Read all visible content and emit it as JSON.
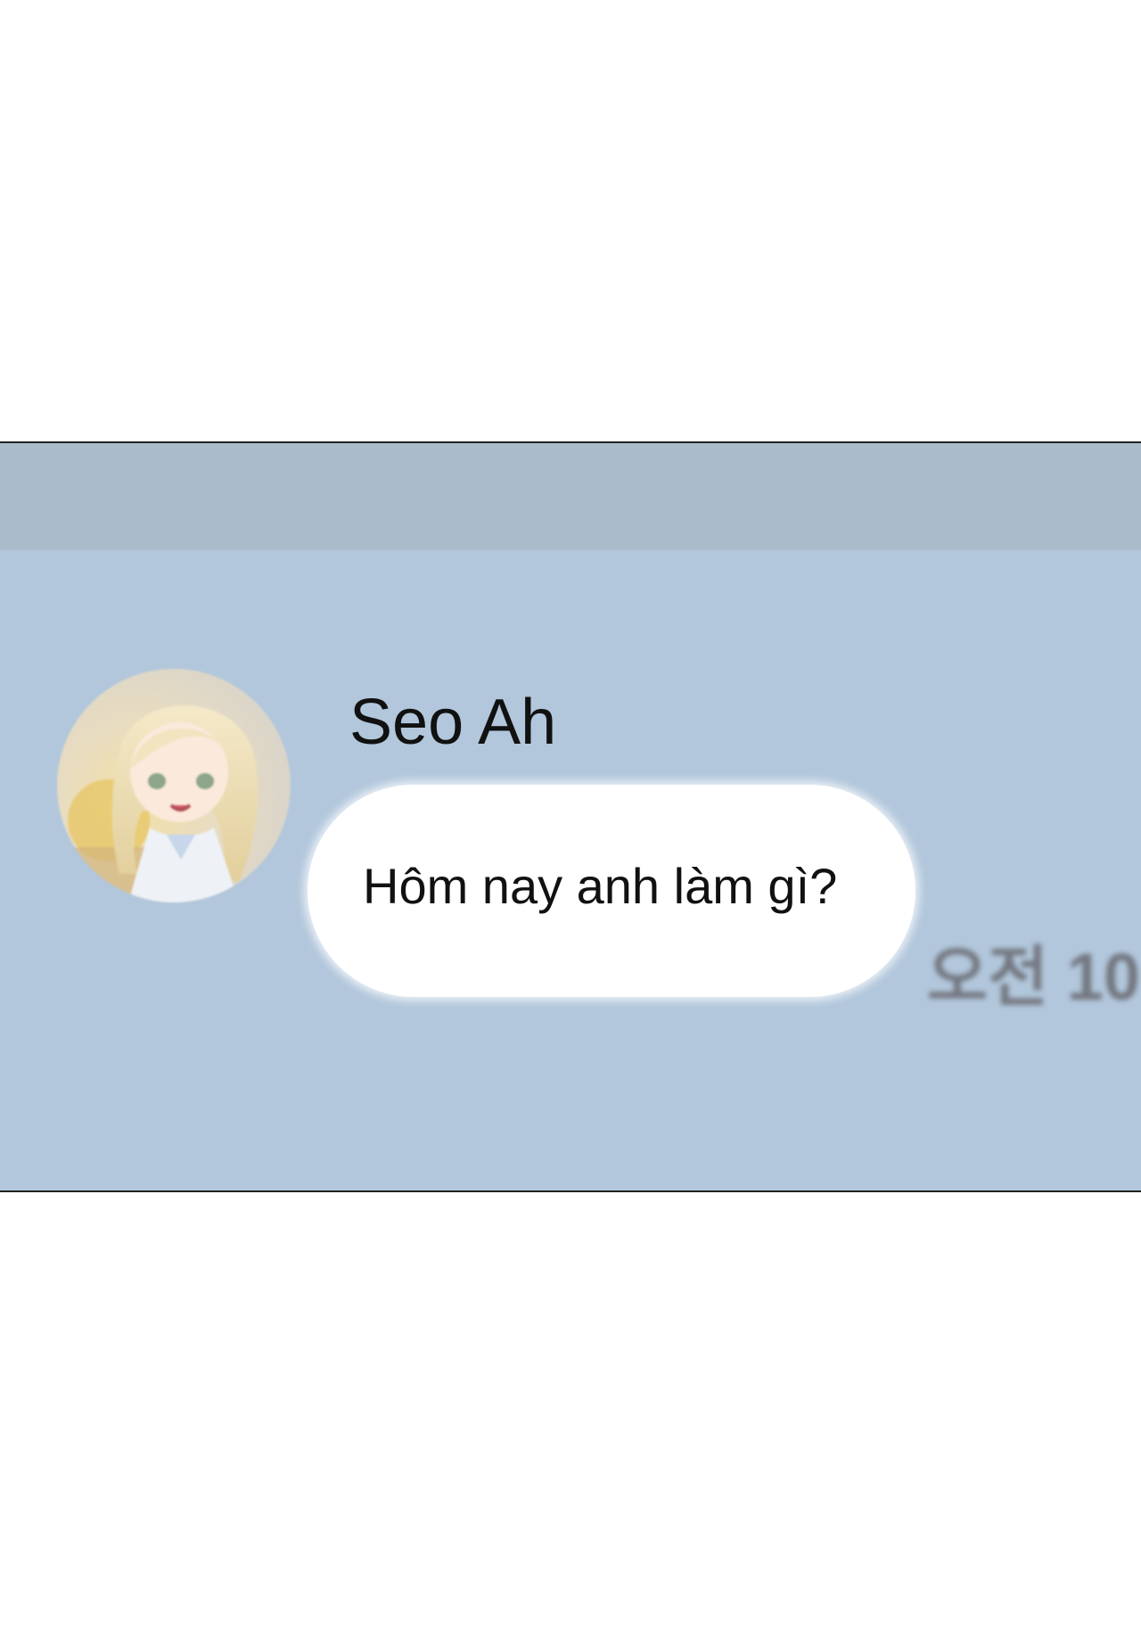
{
  "chat": {
    "sender_name": "Seo Ah",
    "message_text": "Hôm nay anh làm gì?",
    "timestamp": "오전 10",
    "avatar": {
      "icon": "profile-photo-anime-girl"
    }
  },
  "colors": {
    "page_background": "#ffffff",
    "chat_background": "#b2c7dc",
    "header_bar": "#aabbcc",
    "bubble": "#ffffff",
    "text": "#111111",
    "timestamp": "#737780"
  }
}
